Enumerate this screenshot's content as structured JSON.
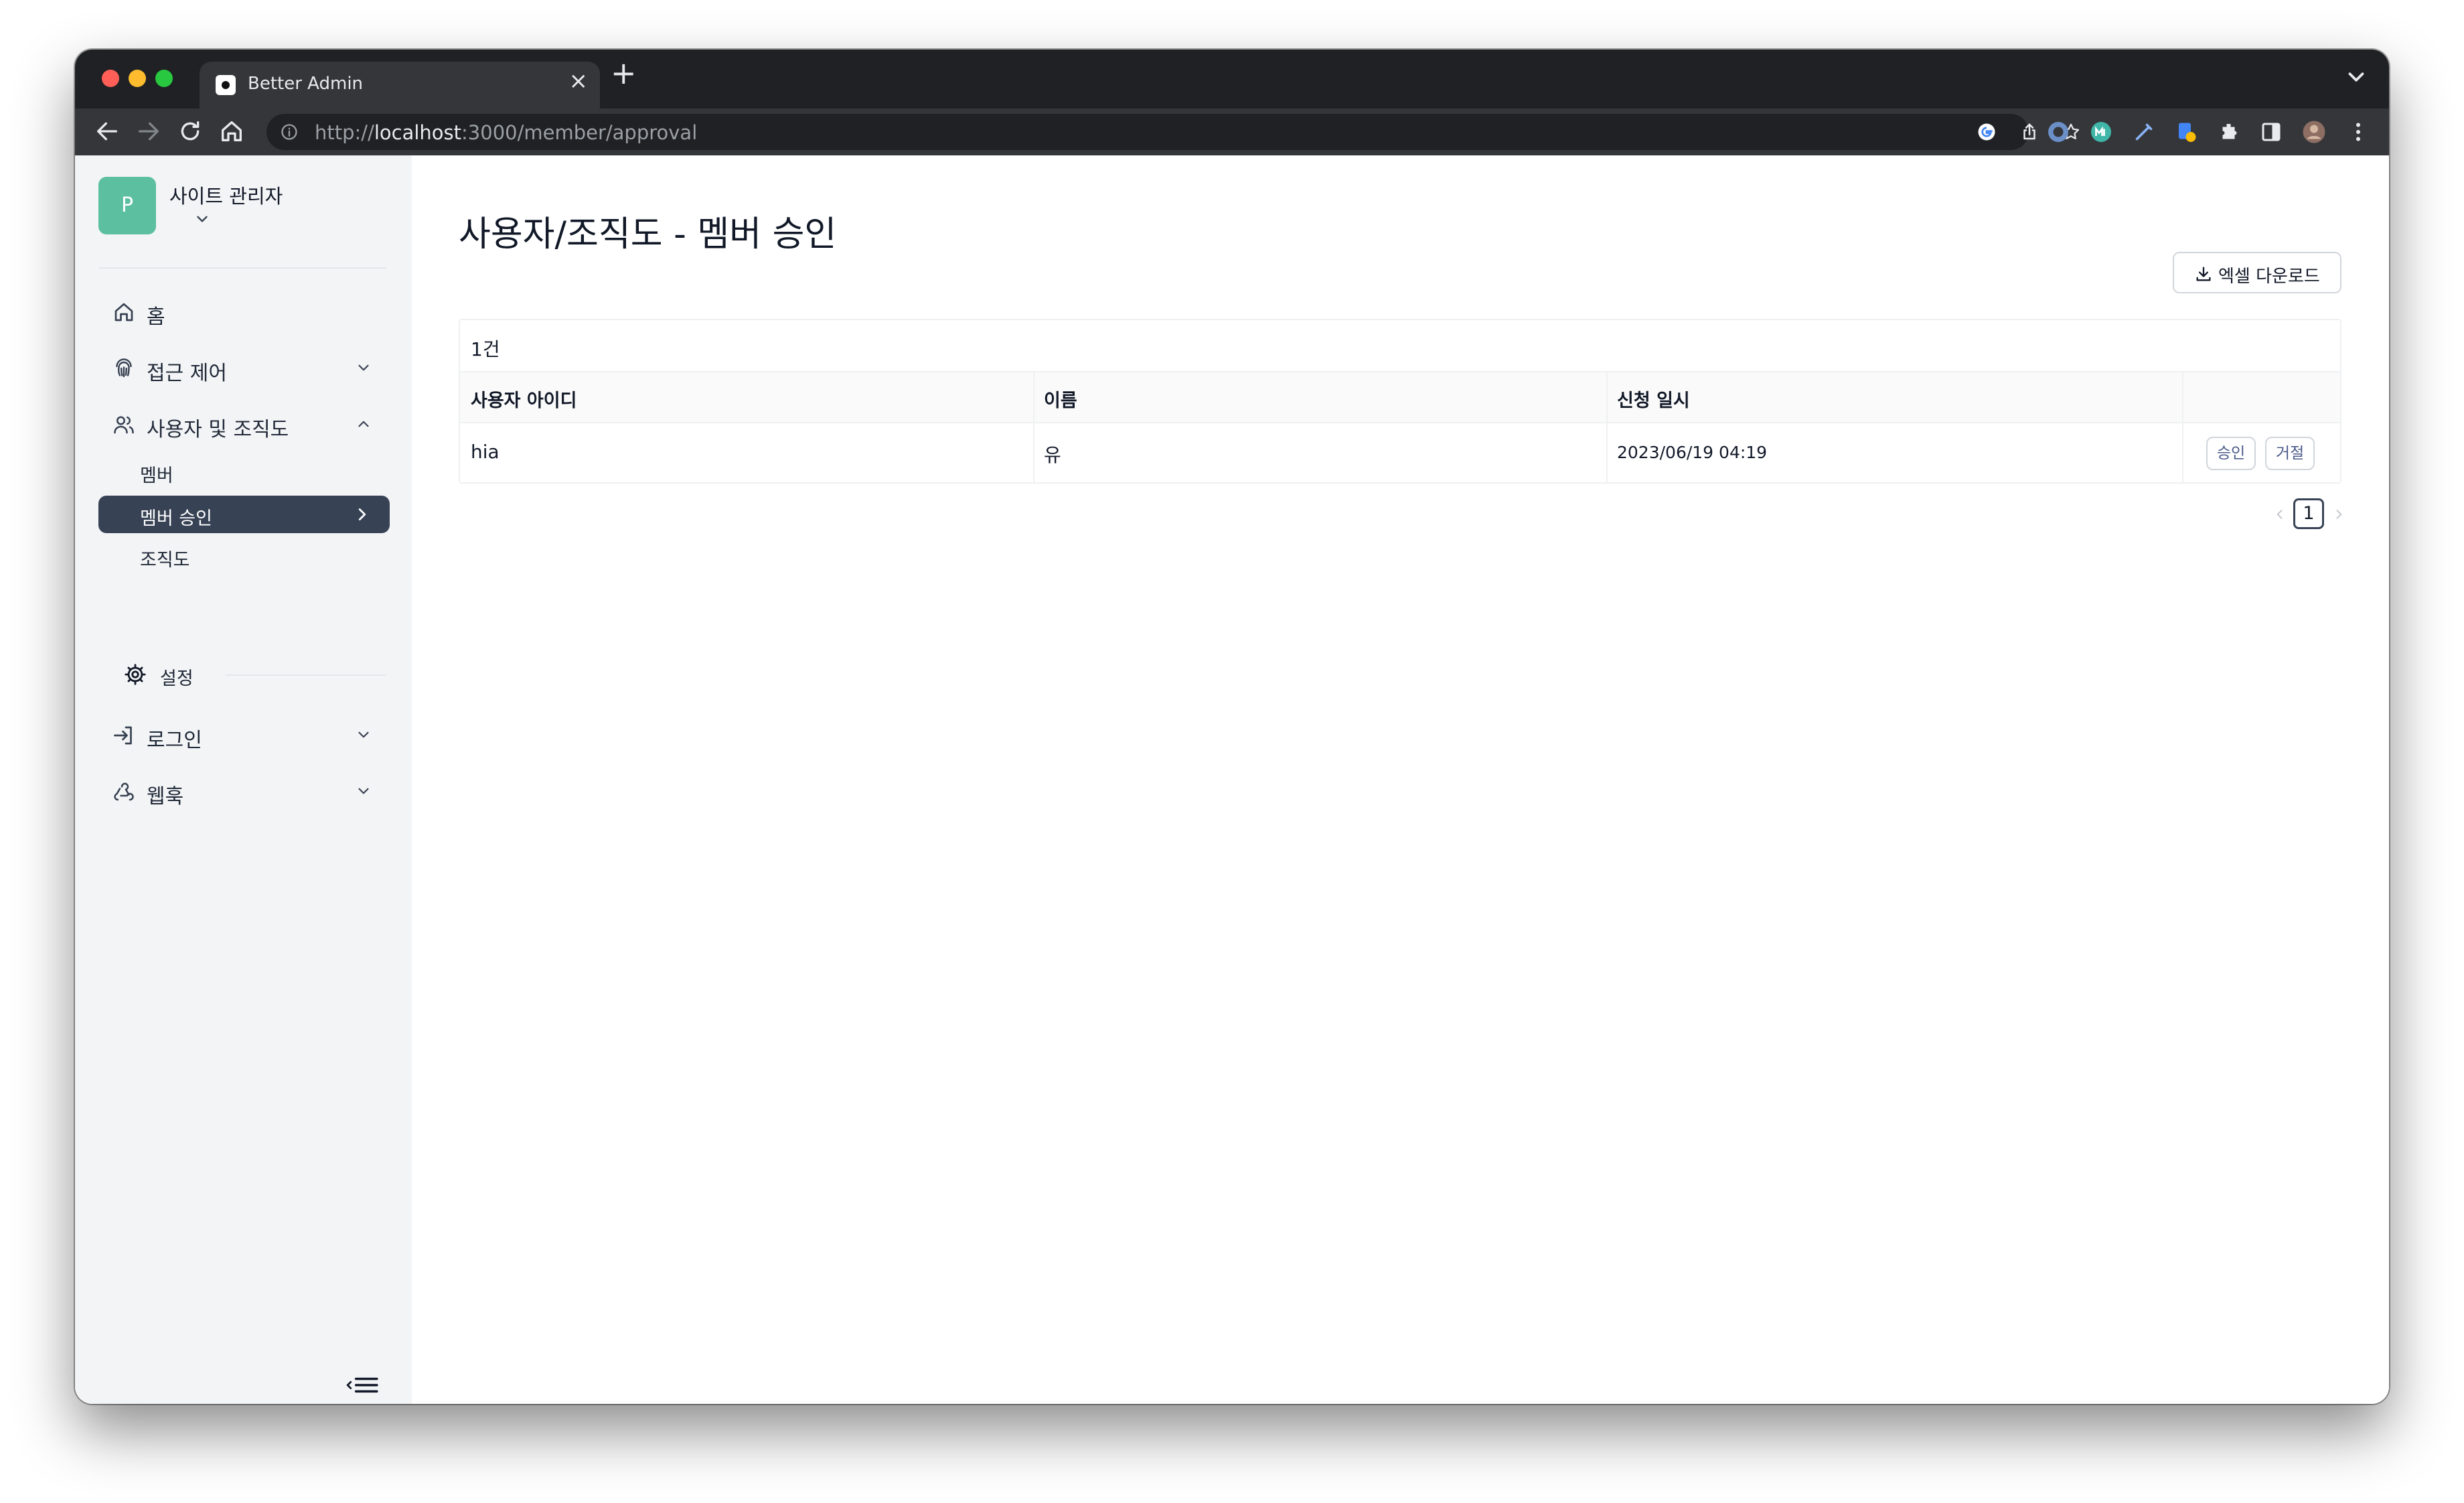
{
  "browser": {
    "tab_title": "Better Admin",
    "tab_close": "×",
    "new_tab": "+",
    "url_scheme": "http://",
    "url_host": "localhost",
    "url_rest": ":3000/member/approval"
  },
  "sidebar": {
    "workspace_initial": "P",
    "workspace_title": "사이트 관리자",
    "nav": {
      "home": "홈",
      "access_control": "접근 제어",
      "users_org": "사용자 및 조직도",
      "login": "로그인",
      "webhook": "웹훅"
    },
    "sub": {
      "member": "멤버",
      "member_approval": "멤버 승인",
      "org_chart": "조직도",
      "settings": "설정"
    }
  },
  "main": {
    "title": "사용자/조직도 - 멤버 승인",
    "excel_button": "엑셀 다운로드",
    "count": "1건",
    "columns": [
      "사용자 아이디",
      "이름",
      "신청 일시"
    ],
    "rows": [
      {
        "user_id": "hia",
        "name": "유",
        "applied_at": "2023/06/19 04:19",
        "approve": "승인",
        "reject": "거절"
      }
    ],
    "pagination": {
      "current": "1"
    }
  },
  "colors": {
    "accent": "#374255",
    "avatar": "#5cbfa0",
    "sidebar_bg": "#f3f4f6"
  }
}
